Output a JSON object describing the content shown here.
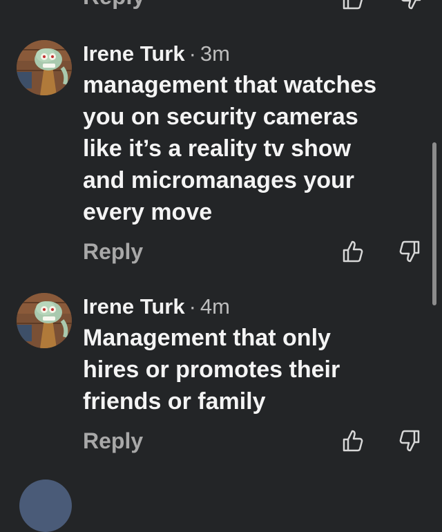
{
  "previous": {
    "reply_label": "Reply"
  },
  "comments": [
    {
      "author": "Irene Turk",
      "separator": "·",
      "time": "3m",
      "text": "management that watches\nyou on security cameras\nlike it’s a reality tv show\nand micromanages your\nevery move",
      "reply_label": "Reply",
      "avatar_icon": "squidward-avatar"
    },
    {
      "author": "Irene Turk",
      "separator": "·",
      "time": "4m",
      "text": "Management that only\nhires or promotes their\nfriends or family",
      "reply_label": "Reply",
      "avatar_icon": "squidward-avatar"
    }
  ],
  "icons": {
    "like": "thumbs-up-icon",
    "dislike": "thumbs-down-icon"
  },
  "colors": {
    "background": "#232527",
    "text": "#f4f4f4",
    "muted": "#a8a8a8"
  }
}
